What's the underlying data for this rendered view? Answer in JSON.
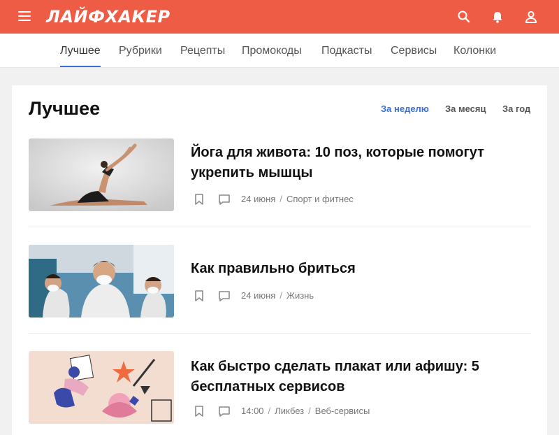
{
  "header": {
    "logo": "ЛАЙФХАКЕР",
    "icons": [
      "menu-icon",
      "search-icon",
      "bell-icon",
      "user-icon"
    ],
    "brand_color": "#ef5c46"
  },
  "nav": {
    "items": [
      "Лучшее",
      "Рубрики",
      "Рецепты",
      "Промокоды",
      "Подкасты",
      "Сервисы",
      "Колонки"
    ],
    "active": "Лучшее",
    "accent_color": "#3a6fd8"
  },
  "main": {
    "title": "Лучшее",
    "periods": [
      "За неделю",
      "За месяц",
      "За год"
    ],
    "active_period": "За неделю"
  },
  "articles": [
    {
      "title_line1": "Йога для живота: 10 поз, которые помогут",
      "title_line2": "укрепить мышцы",
      "date": "24 июня",
      "category": "Спорт и фитнес",
      "category2": ""
    },
    {
      "title_line1": "Как правильно бриться",
      "title_line2": "",
      "date": "24 июня",
      "category": "Жизнь",
      "category2": ""
    },
    {
      "title_line1": "Как быстро сделать плакат или афишу: 5",
      "title_line2": "бесплатных сервисов",
      "date": "14:00",
      "category": "Ликбез",
      "category2": "Веб-сервисы"
    }
  ]
}
